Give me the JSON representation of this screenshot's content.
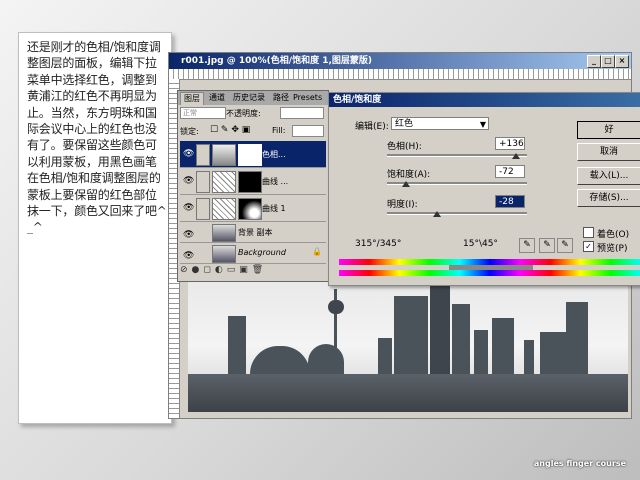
{
  "tutorial_text": "还是刚才的色相/饱和度调整图层的面板，编辑下拉菜单中选择红色，调整到黄浦江的红色不再明显为止。当然，东方明珠和国际会议中心上的红色也没有了。要保留这些颜色可以利用蒙板，用黑色画笔在色相/饱和度调整图层的蒙板上要保留的红色部位抹一下，颜色又回来了吧^_^",
  "doc_window": {
    "title": "r001.jpg @ 100%(色相/饱和度 1,图层蒙版)",
    "buttons": [
      "_",
      "□",
      "×"
    ]
  },
  "layers_panel": {
    "tabs": [
      "图层",
      "通道",
      "历史记录",
      "路径",
      "Presets"
    ],
    "blend_mode": "正常",
    "opacity_label": "不透明度:",
    "lock_label": "锁定:",
    "fill_label": "Fill:",
    "layers": [
      {
        "name": "色相...",
        "selected": true
      },
      {
        "name": "曲线 ...",
        "selected": false
      },
      {
        "name": "曲线 1",
        "selected": false
      },
      {
        "name": "背景 副本",
        "selected": false
      },
      {
        "name": "Background",
        "selected": false
      }
    ],
    "footer_icons": [
      "link-icon",
      "fx-icon",
      "mask-icon",
      "circle-icon",
      "folder-icon",
      "new-layer-icon",
      "trash-icon"
    ]
  },
  "hue_sat_dialog": {
    "title": "色相/饱和度",
    "edit_label": "编辑(E):",
    "edit_value": "红色",
    "hue_label": "色相(H):",
    "hue_value": "+136",
    "saturation_label": "饱和度(A):",
    "saturation_value": "-72",
    "lightness_label": "明度(I):",
    "lightness_value": "-28",
    "range_left": "315°/345°",
    "range_right": "15°\\45°",
    "buttons": {
      "ok": "好",
      "cancel": "取消",
      "load": "载入(L)...",
      "save": "存储(S)..."
    },
    "colorize_label": "着色(O)",
    "colorize_checked": false,
    "preview_label": "预览(P)",
    "preview_checked": true
  },
  "credit": "angles finger course",
  "colors": {
    "title_bar": "#0a246a",
    "dialog_bg": "#d4d0c8",
    "selection": "#0a246a"
  }
}
